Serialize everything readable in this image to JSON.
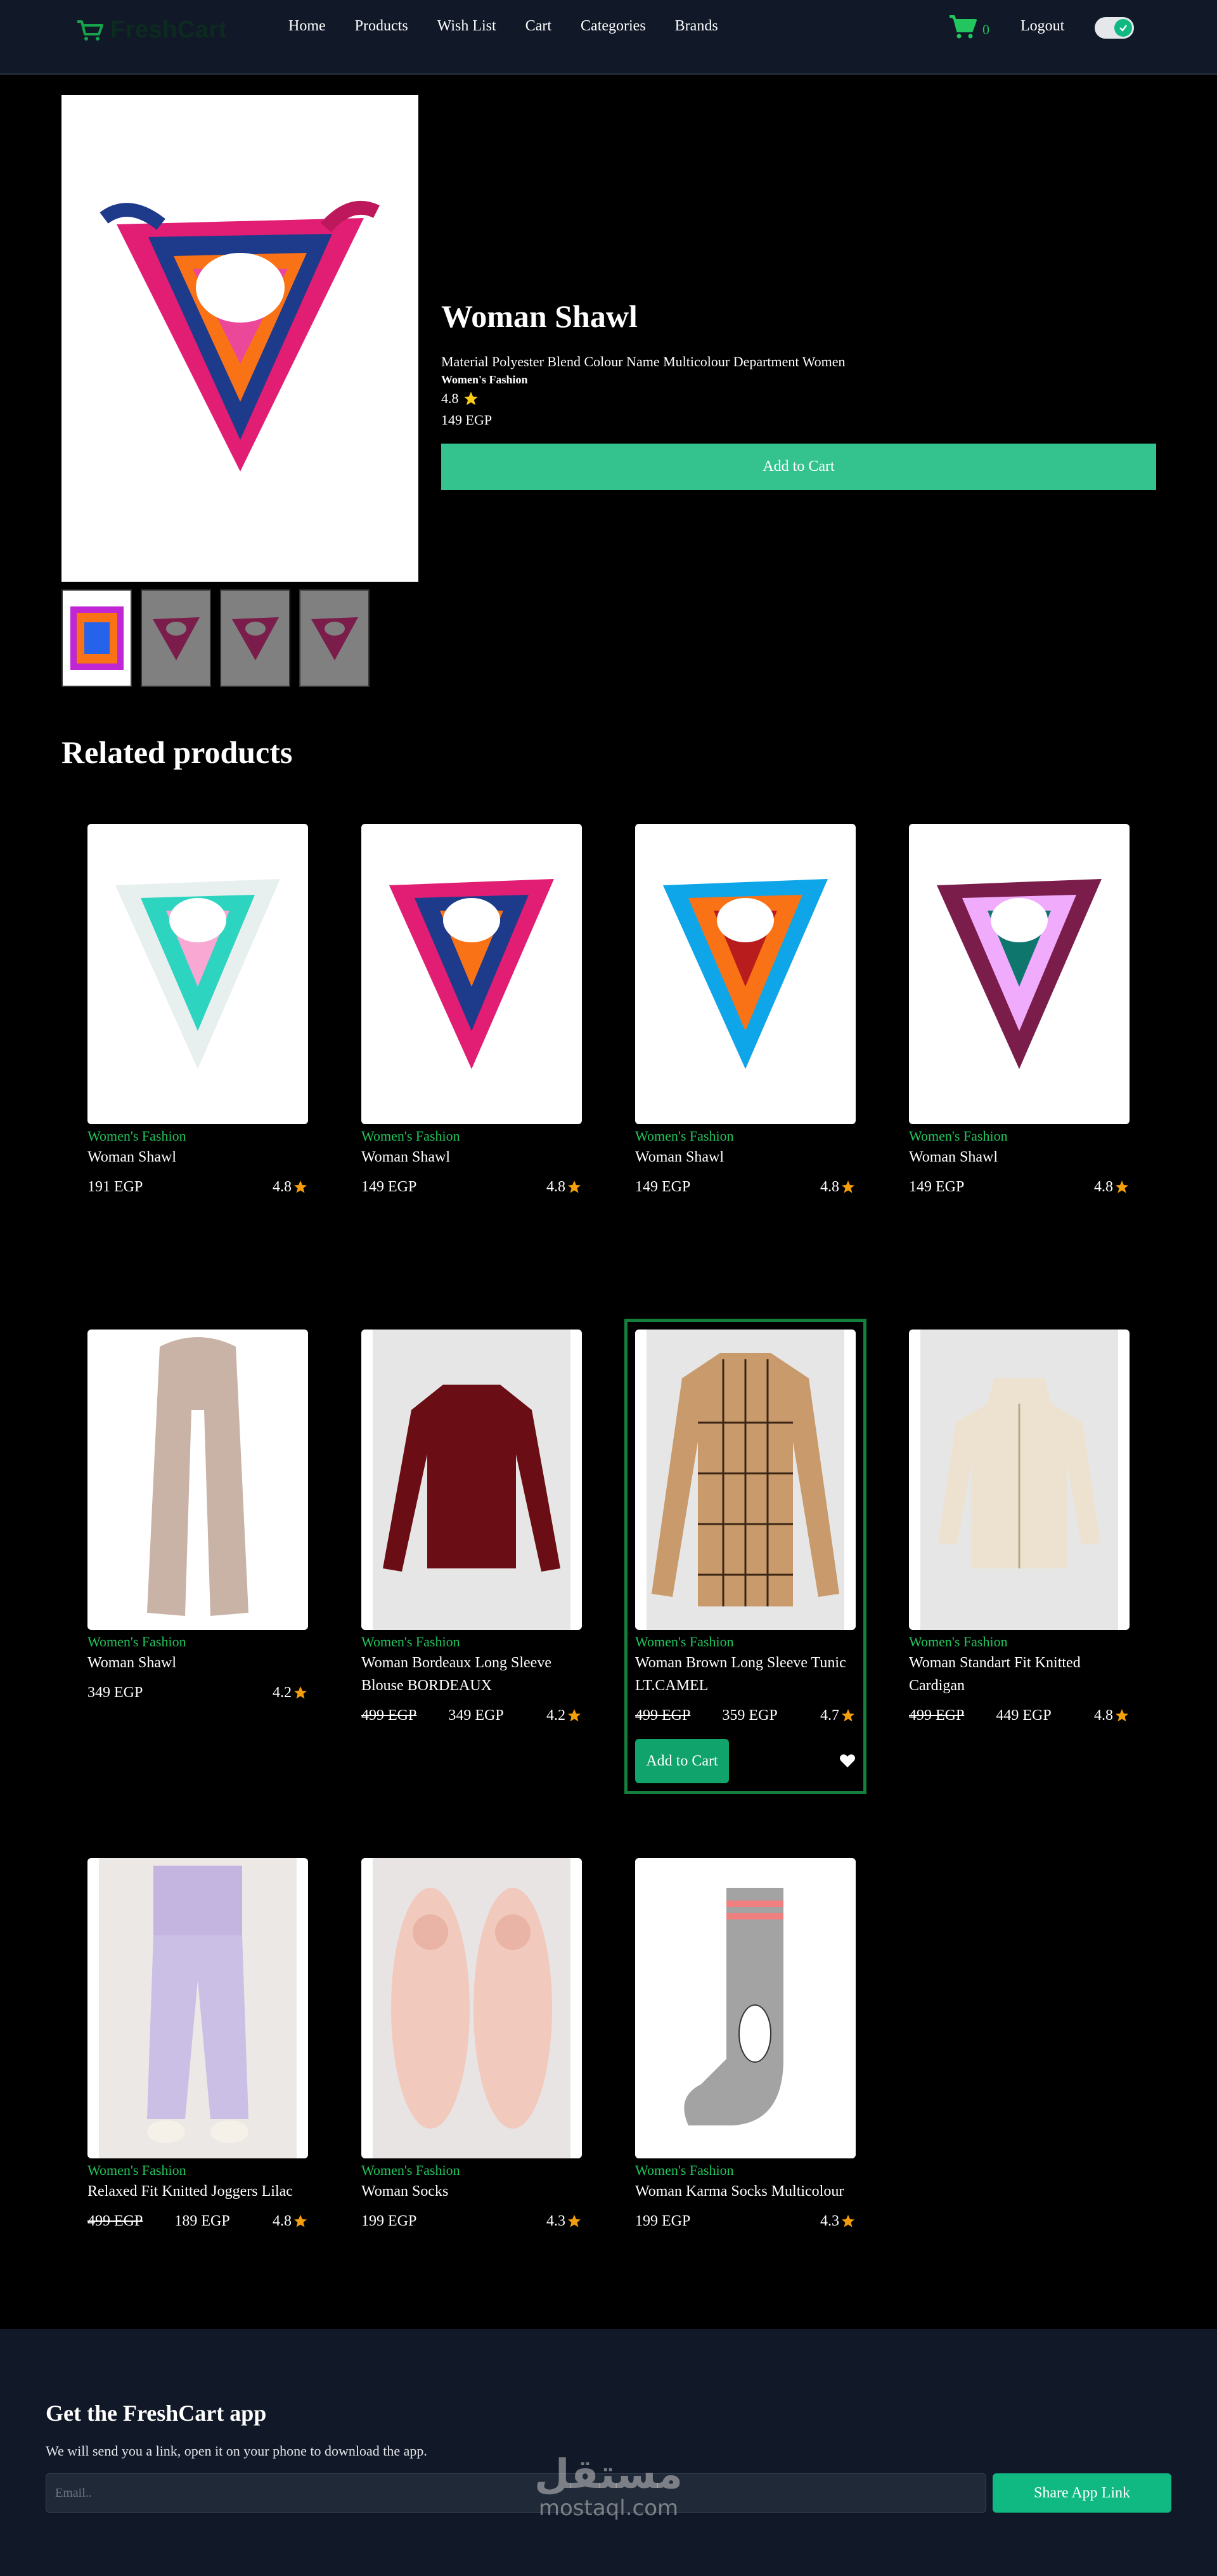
{
  "navbar": {
    "logo_text": "FreshCart",
    "links": [
      "Home",
      "Products",
      "Wish List",
      "Cart",
      "Categories",
      "Brands"
    ],
    "cart_count": "0",
    "logout_label": "Logout",
    "theme_toggle": "on"
  },
  "product": {
    "title": "Woman Shawl",
    "description": "Material Polyester Blend Colour Name Multicolour Department Women",
    "category": "Women's Fashion",
    "rating": "4.8",
    "price": "149 EGP",
    "add_to_cart_label": "Add to Cart",
    "thumbnail_count": 4
  },
  "related_title": "Related products",
  "related_products": [
    {
      "category": "Women's Fashion",
      "name": "Woman Shawl",
      "old_price": "",
      "price": "191 EGP",
      "rating": "4.8"
    },
    {
      "category": "Women's Fashion",
      "name": "Woman Shawl",
      "old_price": "",
      "price": "149 EGP",
      "rating": "4.8"
    },
    {
      "category": "Women's Fashion",
      "name": "Woman Shawl",
      "old_price": "",
      "price": "149 EGP",
      "rating": "4.8"
    },
    {
      "category": "Women's Fashion",
      "name": "Woman Shawl",
      "old_price": "",
      "price": "149 EGP",
      "rating": "4.8"
    },
    {
      "category": "Women's Fashion",
      "name": "Woman Shawl",
      "old_price": "",
      "price": "349 EGP",
      "rating": "4.2"
    },
    {
      "category": "Women's Fashion",
      "name": "Woman Bordeaux Long Sleeve Blouse BORDEAUX",
      "old_price": "499 EGP",
      "price": "349 EGP",
      "rating": "4.2"
    },
    {
      "category": "Women's Fashion",
      "name": "Woman Brown Long Sleeve Tunic LT.CAMEL",
      "old_price": "499 EGP",
      "price": "359 EGP",
      "rating": "4.7",
      "add_to_cart_label": "Add to Cart"
    },
    {
      "category": "Women's Fashion",
      "name": "Woman Standart Fit Knitted Cardigan",
      "old_price": "499 EGP",
      "price": "449 EGP",
      "rating": "4.8"
    },
    {
      "category": "Women's Fashion",
      "name": "Relaxed Fit Knitted Joggers Lilac",
      "old_price": "499 EGP",
      "price": "189 EGP",
      "rating": "4.8"
    },
    {
      "category": "Women's Fashion",
      "name": "Woman Socks",
      "old_price": "",
      "price": "199 EGP",
      "rating": "4.3"
    },
    {
      "category": "Women's Fashion",
      "name": "Woman Karma Socks Multicolour",
      "old_price": "",
      "price": "199 EGP",
      "rating": "4.3"
    }
  ],
  "footer": {
    "title": "Get the FreshCart app",
    "subtitle": "We will send you a link, open it on your phone to download the app.",
    "email_placeholder": "Email..",
    "share_label": "Share App Link"
  },
  "watermark": {
    "arabic": "مستقل",
    "latin": "mostaql.com"
  },
  "colors": {
    "accent": "#34c38f",
    "category_green": "#22c55e",
    "nav_bg": "#111827",
    "star": "#f59e0b",
    "star_yellow": "#facc15"
  }
}
